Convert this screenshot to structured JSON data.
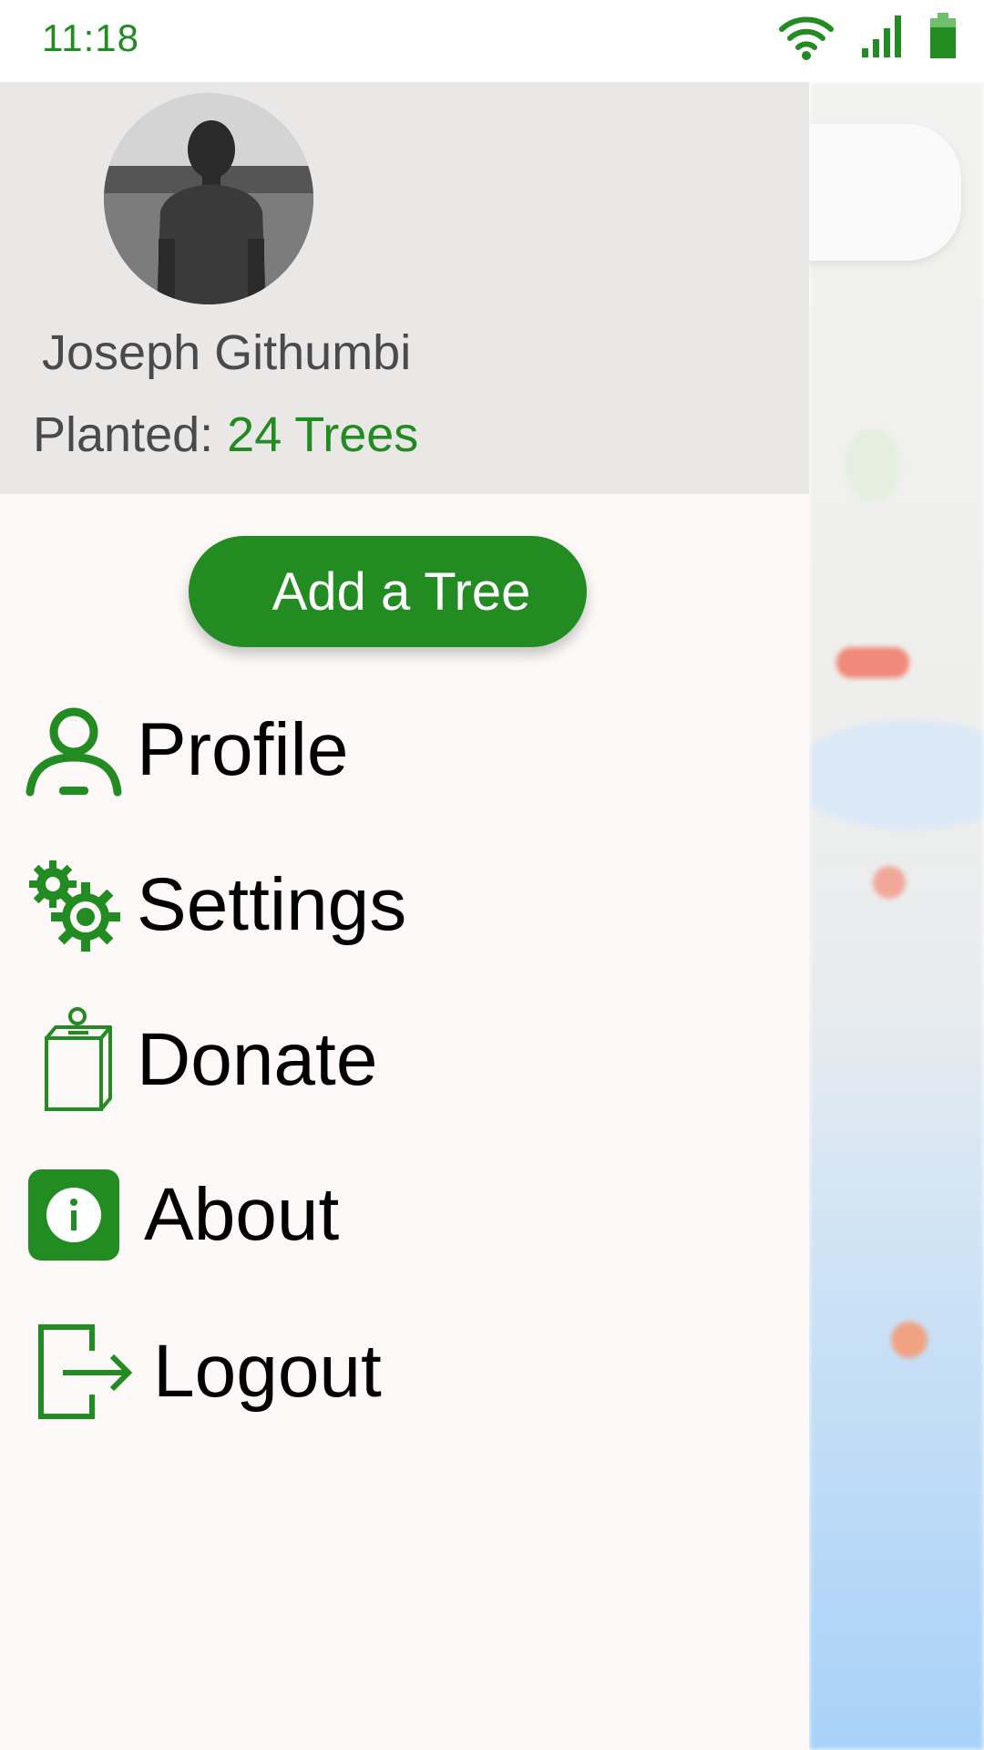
{
  "status_bar": {
    "time": "11:18"
  },
  "drawer": {
    "user": {
      "name": "Joseph Githumbi",
      "planted_label": "Planted:",
      "planted_value": "24 Trees"
    },
    "add_tree_label": "Add a Tree",
    "menu": [
      {
        "label": "Profile",
        "icon": "person-icon"
      },
      {
        "label": "Settings",
        "icon": "gears-icon"
      },
      {
        "label": "Donate",
        "icon": "donation-box-icon"
      },
      {
        "label": "About",
        "icon": "info-icon"
      },
      {
        "label": "Logout",
        "icon": "logout-icon"
      }
    ]
  },
  "colors": {
    "accent": "#228B22",
    "header_bg": "#eae7e7",
    "drawer_bg": "#fcf9f8"
  }
}
